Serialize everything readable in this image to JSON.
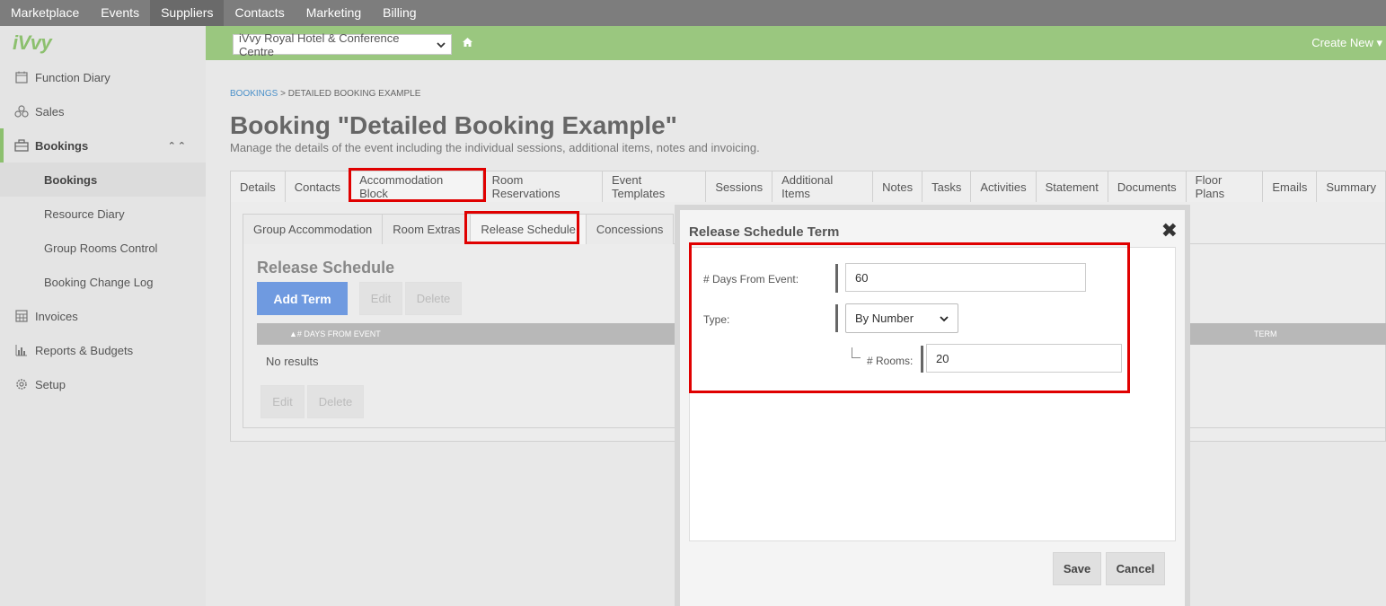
{
  "topnav": {
    "items": [
      "Marketplace",
      "Events",
      "Suppliers",
      "Contacts",
      "Marketing",
      "Billing"
    ]
  },
  "sidebar": {
    "logo": "iVvy",
    "items": [
      {
        "label": "Function Diary",
        "icon": "calendar-icon"
      },
      {
        "label": "Sales",
        "icon": "sales-icon"
      },
      {
        "label": "Bookings",
        "icon": "briefcase-icon"
      },
      {
        "label": "Invoices",
        "icon": "calculator-icon"
      },
      {
        "label": "Reports & Budgets",
        "icon": "bar-chart-icon"
      },
      {
        "label": "Setup",
        "icon": "gear-icon"
      }
    ],
    "bookings_chevron": "⌃⌃",
    "sub_items": [
      "Bookings",
      "Resource Diary",
      "Group Rooms Control",
      "Booking Change Log"
    ]
  },
  "header": {
    "venue": "iVvy Royal Hotel & Conference Centre",
    "create_new": "Create New"
  },
  "breadcrumb": {
    "root": "BOOKINGS",
    "separator": ">",
    "current": "DETAILED BOOKING EXAMPLE"
  },
  "page": {
    "title": "Booking \"Detailed Booking Example\"",
    "subtitle": "Manage the details of the event including the individual sessions, additional items, notes and invoicing."
  },
  "tabs": [
    "Details",
    "Contacts",
    "Accommodation Block",
    "Room Reservations",
    "Event Templates",
    "Sessions",
    "Additional Items",
    "Notes",
    "Tasks",
    "Activities",
    "Statement",
    "Documents",
    "Floor Plans",
    "Emails",
    "Summary"
  ],
  "subtabs": [
    "Group Accommodation",
    "Room Extras",
    "Release Schedule",
    "Concessions"
  ],
  "release_schedule": {
    "title": "Release Schedule",
    "add_term": "Add Term",
    "edit": "Edit",
    "delete": "Delete",
    "col_days": "▲# DAYS FROM EVENT",
    "col_term": "TERM",
    "no_results": "No results"
  },
  "modal": {
    "title": "Release Schedule Term",
    "close": "✖",
    "days_label": "# Days From Event:",
    "days_value": "60",
    "type_label": "Type:",
    "type_value": "By Number",
    "rooms_label": "# Rooms:",
    "rooms_value": "20",
    "save": "Save",
    "cancel": "Cancel"
  },
  "colors": {
    "accent_green": "#9ac77f",
    "primary_blue": "#6f9ae0",
    "highlight_red": "#e00000"
  }
}
